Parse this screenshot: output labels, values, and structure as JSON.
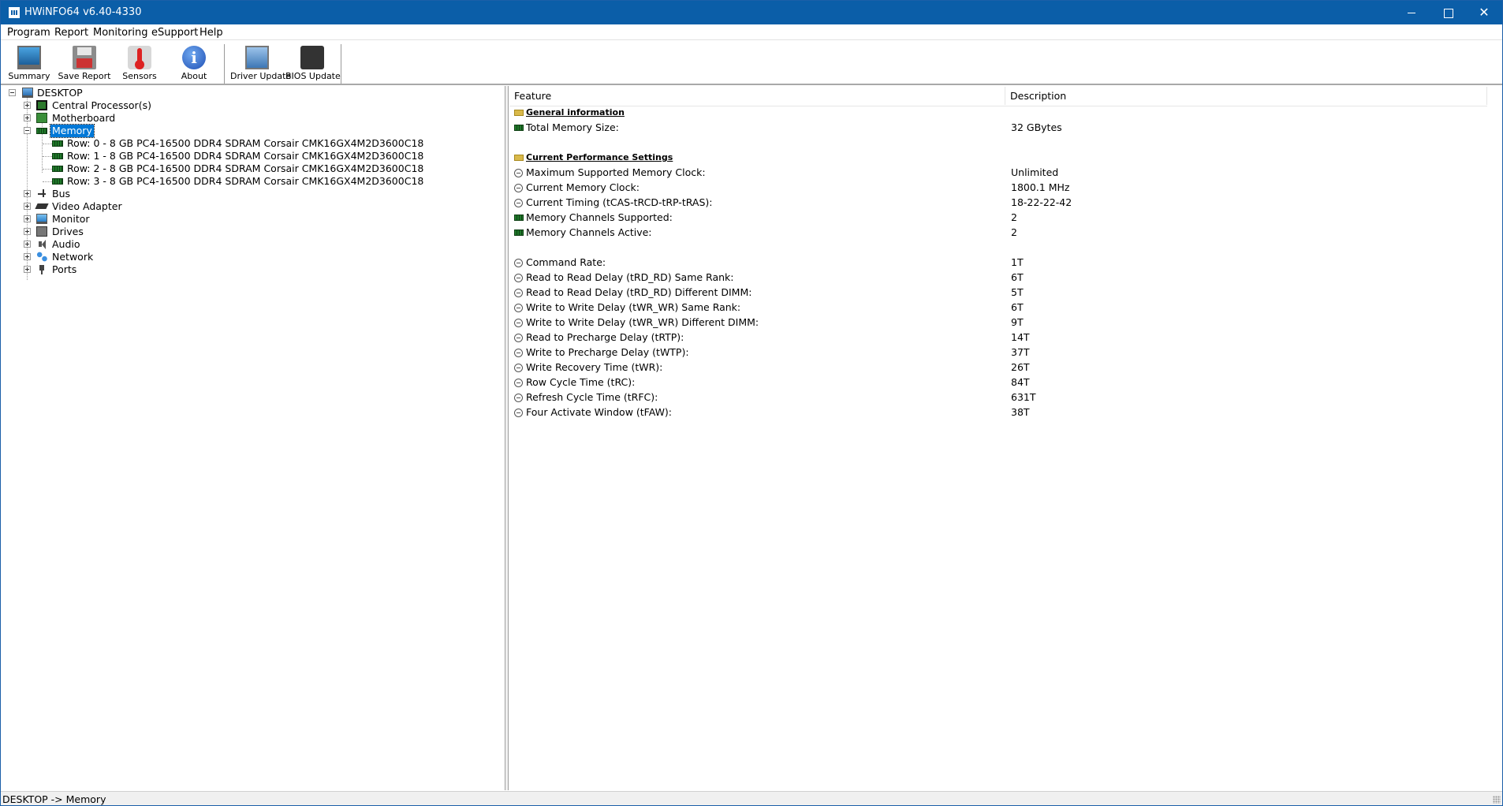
{
  "window": {
    "title": "HWiNFO64 v6.40-4330"
  },
  "menu": [
    "Program",
    "Report",
    "Monitoring",
    "eSupport",
    "Help"
  ],
  "toolbar": {
    "summary": "Summary",
    "save_report": "Save Report",
    "sensors": "Sensors",
    "about": "About",
    "driver_update": "Driver Update",
    "bios_update": "BIOS Update"
  },
  "tree": {
    "root": "DESKTOP",
    "cpu": "Central Processor(s)",
    "motherboard": "Motherboard",
    "memory": "Memory",
    "rows": [
      "Row: 0 - 8 GB PC4-16500 DDR4 SDRAM Corsair CMK16GX4M2D3600C18",
      "Row: 1 - 8 GB PC4-16500 DDR4 SDRAM Corsair CMK16GX4M2D3600C18",
      "Row: 2 - 8 GB PC4-16500 DDR4 SDRAM Corsair CMK16GX4M2D3600C18",
      "Row: 3 - 8 GB PC4-16500 DDR4 SDRAM Corsair CMK16GX4M2D3600C18"
    ],
    "bus": "Bus",
    "video": "Video Adapter",
    "monitor": "Monitor",
    "drives": "Drives",
    "audio": "Audio",
    "network": "Network",
    "ports": "Ports"
  },
  "details": {
    "columns": [
      "Feature",
      "Description"
    ],
    "general_title": "General information",
    "total_memory": {
      "feature": "Total Memory Size:",
      "value": "32 GBytes"
    },
    "perf_title": "Current Performance Settings",
    "perf": [
      {
        "feature": "Maximum Supported Memory Clock:",
        "value": "Unlimited",
        "icon": "clock"
      },
      {
        "feature": "Current Memory Clock:",
        "value": "1800.1 MHz",
        "icon": "clock"
      },
      {
        "feature": "Current Timing (tCAS-tRCD-tRP-tRAS):",
        "value": "18-22-22-42",
        "icon": "clock"
      },
      {
        "feature": "Memory Channels Supported:",
        "value": "2",
        "icon": "memchip"
      },
      {
        "feature": "Memory Channels Active:",
        "value": "2",
        "icon": "memchip"
      }
    ],
    "timings": [
      {
        "feature": "Command Rate:",
        "value": "1T"
      },
      {
        "feature": "Read to Read Delay (tRD_RD) Same Rank:",
        "value": "6T"
      },
      {
        "feature": "Read to Read Delay (tRD_RD) Different DIMM:",
        "value": "5T"
      },
      {
        "feature": "Write to Write Delay (tWR_WR) Same Rank:",
        "value": "6T"
      },
      {
        "feature": "Write to Write Delay (tWR_WR) Different DIMM:",
        "value": "9T"
      },
      {
        "feature": "Read to Precharge Delay (tRTP):",
        "value": "14T"
      },
      {
        "feature": "Write to Precharge Delay (tWTP):",
        "value": "37T"
      },
      {
        "feature": "Write Recovery Time (tWR):",
        "value": "26T"
      },
      {
        "feature": "Row Cycle Time (tRC):",
        "value": "84T"
      },
      {
        "feature": "Refresh Cycle Time (tRFC):",
        "value": "631T"
      },
      {
        "feature": "Four Activate Window (tFAW):",
        "value": "38T"
      }
    ]
  },
  "status": {
    "path": "DESKTOP -> Memory"
  }
}
